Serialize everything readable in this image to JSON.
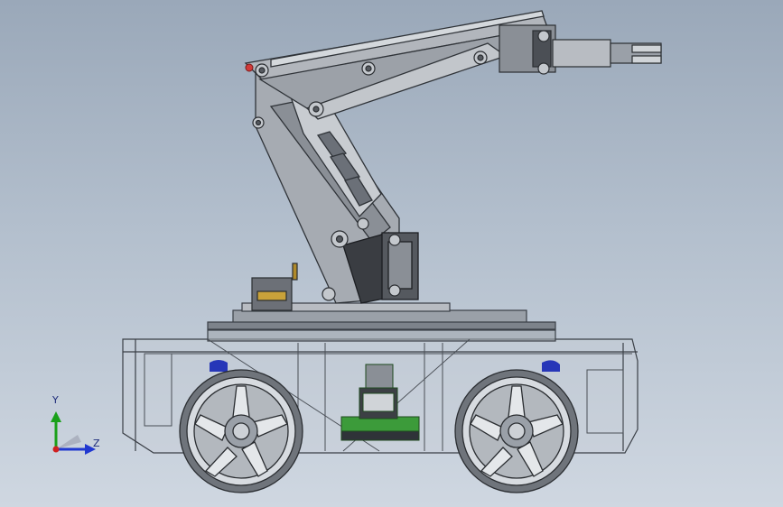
{
  "viewport": {
    "background_top": "#9aa8b9",
    "background_bottom": "#cfd7e1"
  },
  "model": {
    "subject": "mobile-robot-with-arm",
    "colors": {
      "chassis_line": "#3a3f46",
      "metal": "#8a8f96",
      "metal_dark": "#55595f",
      "board_green": "#3c9b3a",
      "accent_blue": "#2636b8",
      "accent_copper": "#b8705a",
      "accent_red": "#d23a3a"
    }
  },
  "triad": {
    "y_label": "Y",
    "z_label": "Z",
    "y_color": "#1aa01a",
    "z_color": "#2038d0",
    "origin_color": "#d02020"
  }
}
